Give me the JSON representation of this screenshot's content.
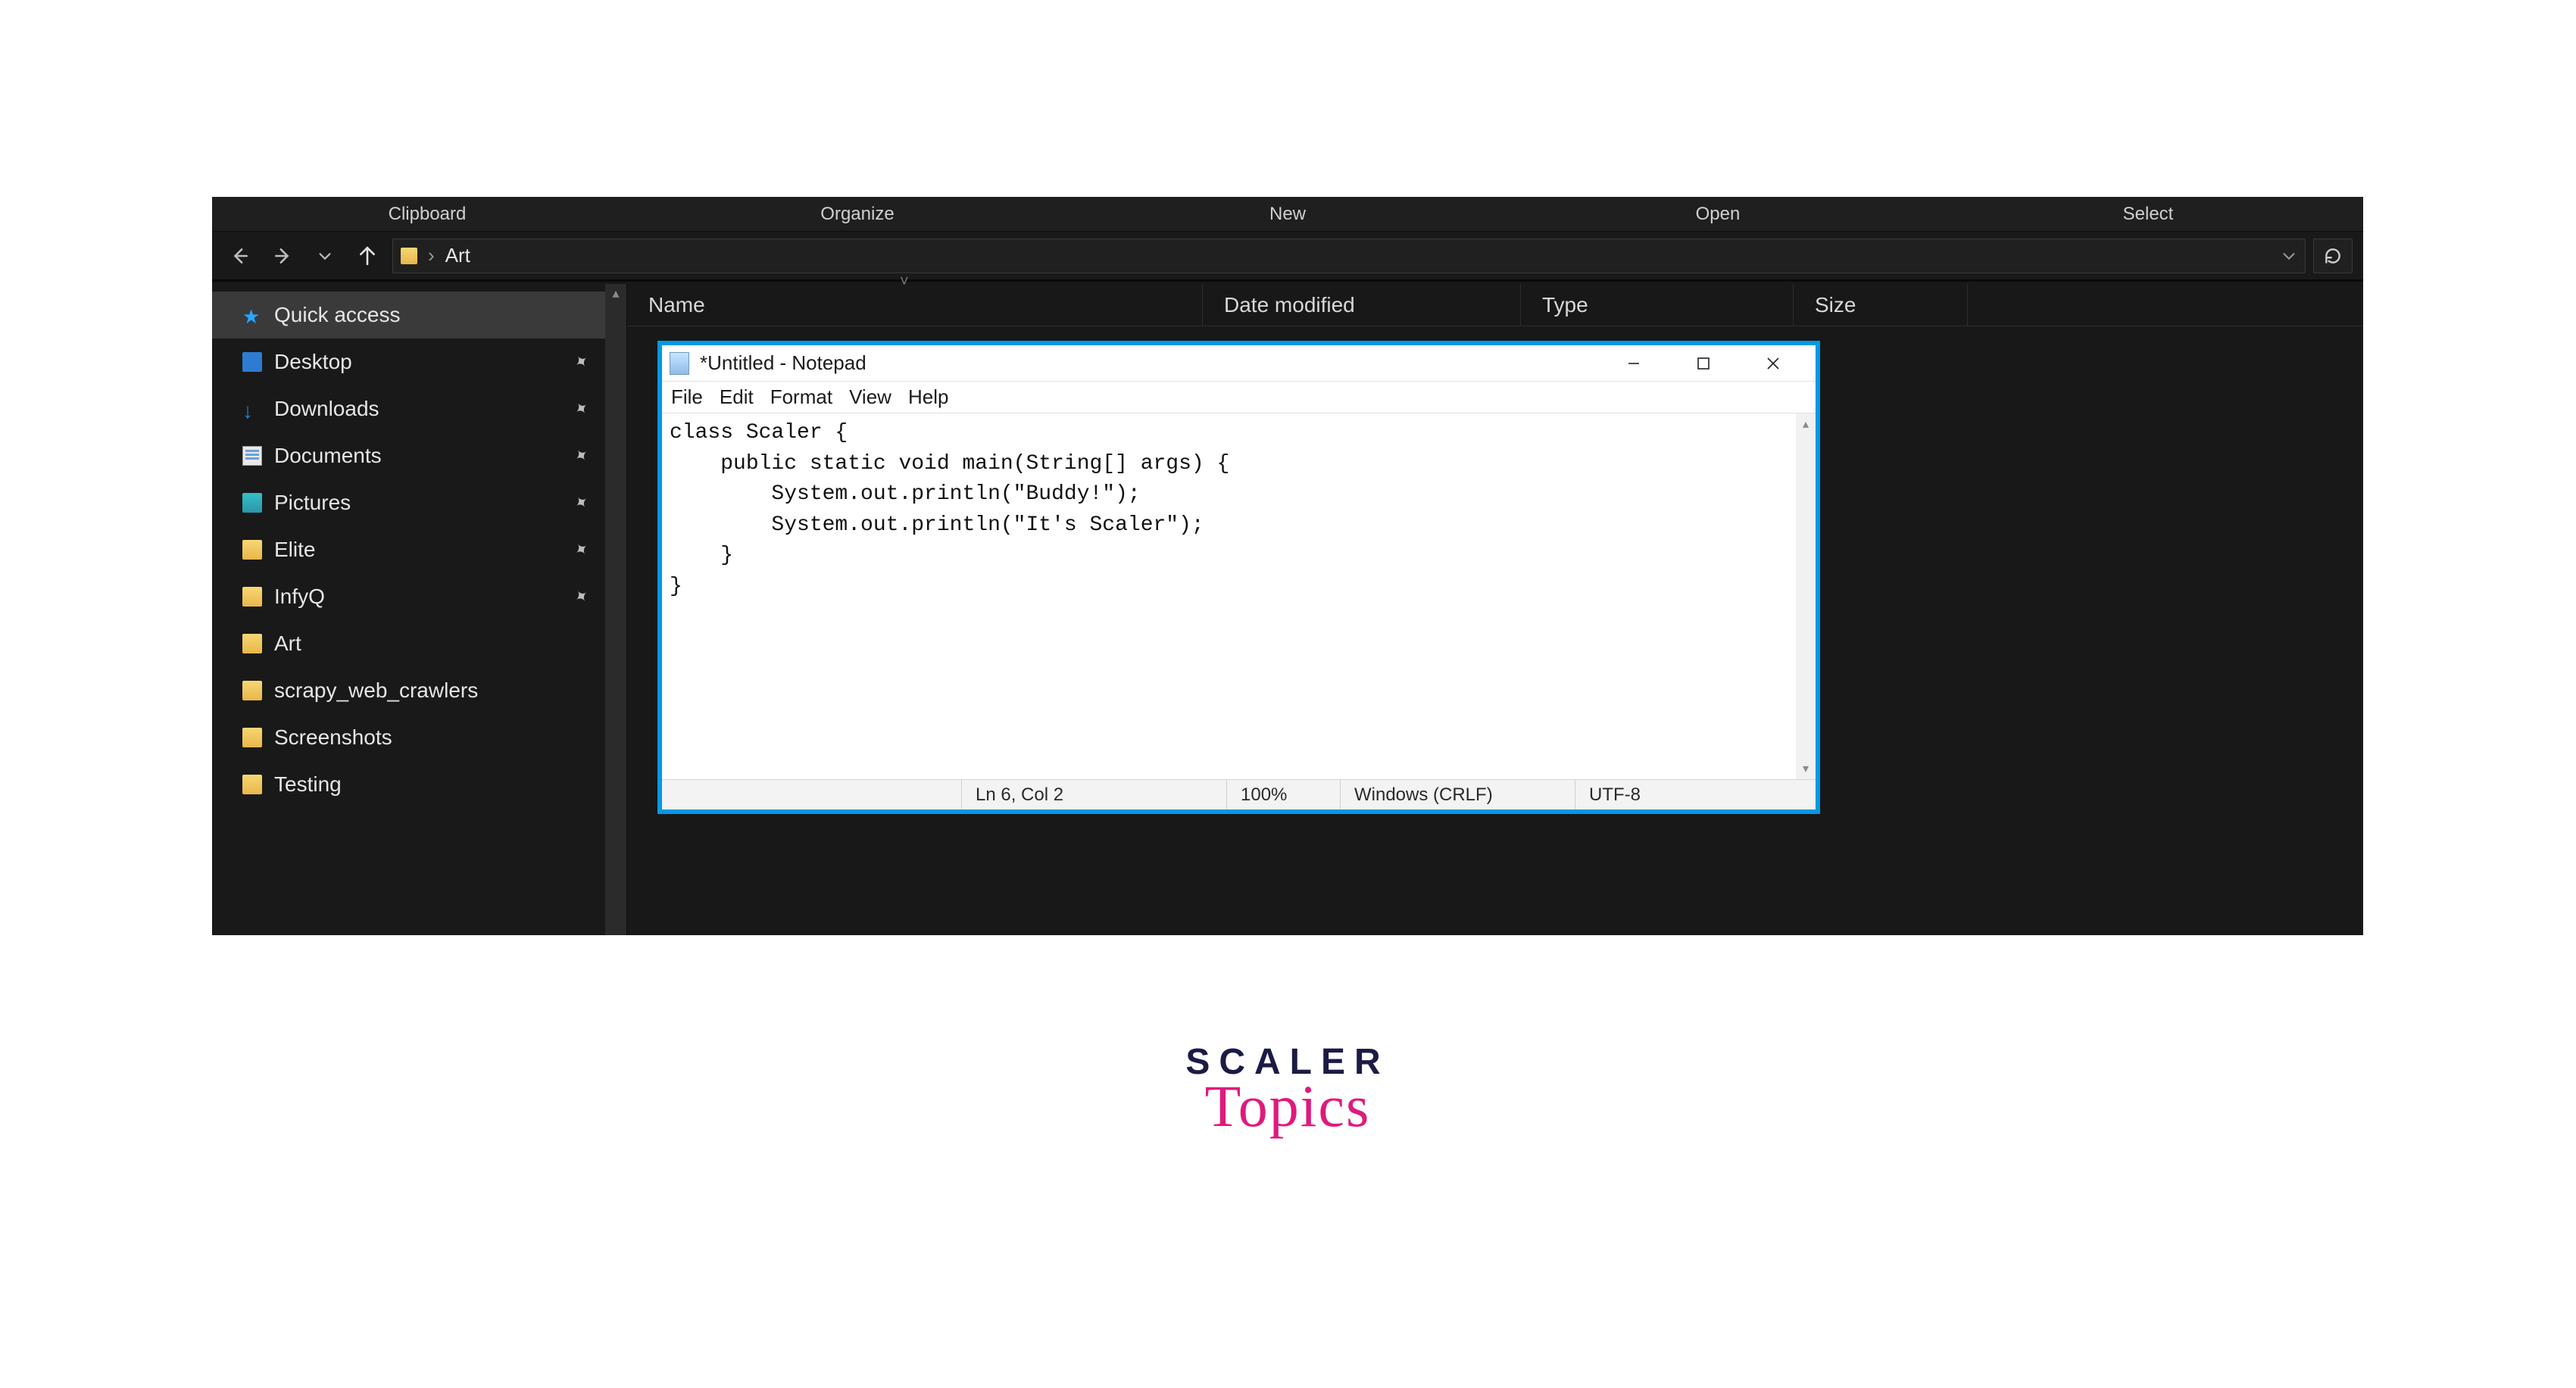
{
  "ribbon": {
    "tabs": [
      "Clipboard",
      "Organize",
      "New",
      "Open",
      "Select"
    ]
  },
  "address": {
    "folder": "Art"
  },
  "sidebar": {
    "items": [
      {
        "label": "Quick access",
        "icon": "star",
        "pinned": false,
        "active": true
      },
      {
        "label": "Desktop",
        "icon": "desktop",
        "pinned": true,
        "active": false
      },
      {
        "label": "Downloads",
        "icon": "down",
        "pinned": true,
        "active": false
      },
      {
        "label": "Documents",
        "icon": "doc",
        "pinned": true,
        "active": false
      },
      {
        "label": "Pictures",
        "icon": "pic",
        "pinned": true,
        "active": false
      },
      {
        "label": "Elite",
        "icon": "folder",
        "pinned": true,
        "active": false
      },
      {
        "label": "InfyQ",
        "icon": "folder",
        "pinned": true,
        "active": false
      },
      {
        "label": "Art",
        "icon": "folder",
        "pinned": false,
        "active": false
      },
      {
        "label": "scrapy_web_crawlers",
        "icon": "folder",
        "pinned": false,
        "active": false
      },
      {
        "label": "Screenshots",
        "icon": "folder",
        "pinned": false,
        "active": false
      },
      {
        "label": "Testing",
        "icon": "folder",
        "pinned": false,
        "active": false
      }
    ]
  },
  "columns": {
    "name": "Name",
    "date": "Date modified",
    "type": "Type",
    "size": "Size"
  },
  "notepad": {
    "title": "*Untitled - Notepad",
    "menu": [
      "File",
      "Edit",
      "Format",
      "View",
      "Help"
    ],
    "content": "class Scaler {\n    public static void main(String[] args) {\n        System.out.println(\"Buddy!\");\n        System.out.println(\"It's Scaler\");\n    }\n}",
    "status": {
      "pos": "Ln 6, Col 2",
      "zoom": "100%",
      "eol": "Windows (CRLF)",
      "enc": "UTF-8"
    }
  },
  "logo": {
    "word": "SCALER",
    "script": "Topics"
  }
}
